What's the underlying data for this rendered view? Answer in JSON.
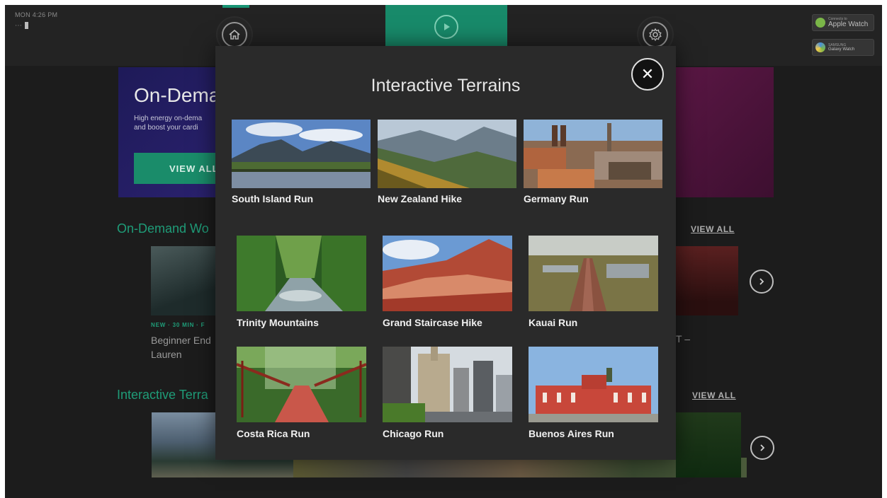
{
  "topbar": {
    "clock": "MON 4:26 PM",
    "home_icon": "home-icon",
    "play_icon": "play-icon",
    "settings_icon": "gear-icon",
    "apple_badge_small": "Connects to",
    "apple_badge": "Apple Watch",
    "samsung_badge_small": "SAMSUNG",
    "samsung_badge": "Galaxy Watch",
    "accent": "#188a6a"
  },
  "background": {
    "hero_title": "On-Dema",
    "hero_desc_line1": "High energy on-dema",
    "hero_desc_line2": "and boost your cardi",
    "hero_button": "VIEW ALL",
    "section1_title": "On-Demand Wo",
    "section1_view_all": "VIEW ALL",
    "section1_card_meta": "NEW · 30 MIN · F",
    "section1_card_title_line1": "Beginner End",
    "section1_card_title_line2": "Lauren",
    "section1_card_right_title": "T –",
    "section2_title": "Interactive Terra",
    "section2_view_all": "VIEW ALL"
  },
  "modal": {
    "title": "Interactive Terrains",
    "close_icon": "close-icon",
    "close_symbol": "✕",
    "terrains": [
      {
        "label": "South Island Run"
      },
      {
        "label": "New Zealand Hike"
      },
      {
        "label": "Germany Run"
      },
      {
        "label": "Trinity Mountains"
      },
      {
        "label": "Grand Staircase Hike"
      },
      {
        "label": "Kauai Run"
      },
      {
        "label": "Costa Rica Run"
      },
      {
        "label": "Chicago Run"
      },
      {
        "label": "Buenos Aires Run"
      }
    ]
  }
}
